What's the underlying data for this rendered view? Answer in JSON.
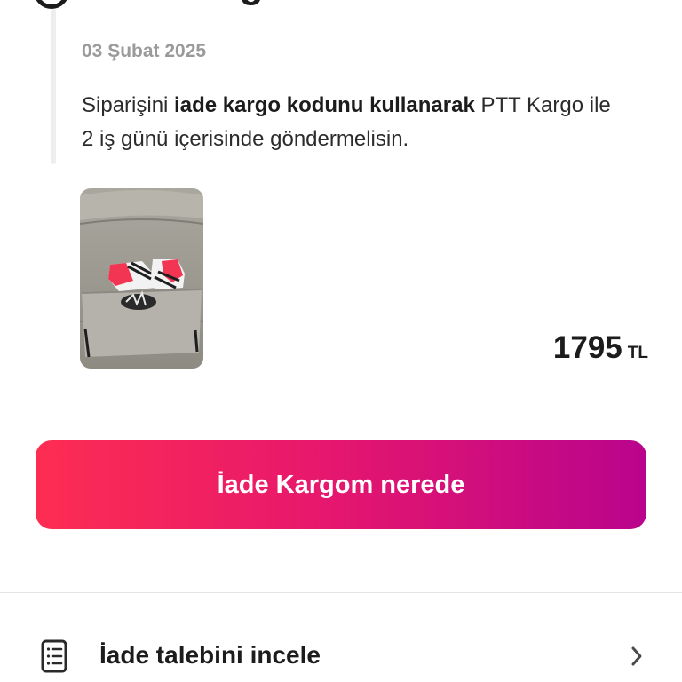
{
  "status": {
    "title": "İade Kargo Gönderildi",
    "date": "03 Şubat 2025",
    "description": {
      "before": "Siparişini ",
      "emphasis": "iade kargo kodunu kullanarak",
      "after": " PTT Kargo ile 2 iş günü içerisinde göndermelisin."
    },
    "icon": "status-circle-icon"
  },
  "product": {
    "image_icon": "product-image-sneakers",
    "price_value": "1795",
    "price_currency": "TL"
  },
  "cta": {
    "label": "İade Kargom nerede",
    "gradient_start": "#fd2d52",
    "gradient_end": "#b9048c"
  },
  "actions": [
    {
      "label": "İade talebini incele",
      "icon": "document-list-icon",
      "trailing_icon": "chevron-right-icon"
    }
  ]
}
